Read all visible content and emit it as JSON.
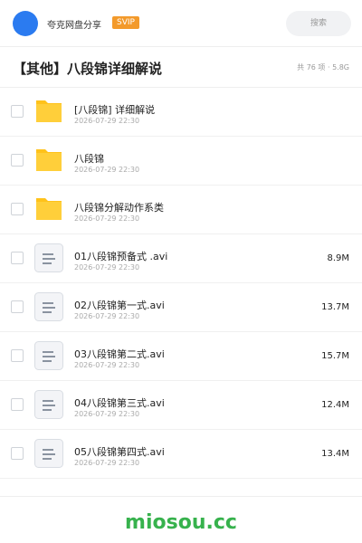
{
  "topbar": {
    "app_name": "夸克网盘分享",
    "badge": "SVIP",
    "search_label": "搜索"
  },
  "header": {
    "title": "【其他】八段锦详细解说",
    "summary": "共 76 项 · 5.8G"
  },
  "files": [
    {
      "name": " [八段锦] 详细解说",
      "date": "2026-07-29 22:30",
      "size": "",
      "type": "folder"
    },
    {
      "name": "八段锦",
      "date": "2026-07-29 22:30",
      "size": "",
      "type": "folder"
    },
    {
      "name": "八段锦分解动作系类",
      "date": "2026-07-29 22:30",
      "size": "",
      "type": "folder"
    },
    {
      "name": "01八段锦预备式 .avi",
      "date": "2026-07-29 22:30",
      "size": "8.9M",
      "type": "video"
    },
    {
      "name": "02八段锦第一式.avi",
      "date": "2026-07-29 22:30",
      "size": "13.7M",
      "type": "video"
    },
    {
      "name": "03八段锦第二式.avi",
      "date": "2026-07-29 22:30",
      "size": "15.7M",
      "type": "video"
    },
    {
      "name": "04八段锦第三式.avi",
      "date": "2026-07-29 22:30",
      "size": "12.4M",
      "type": "video"
    },
    {
      "name": "05八段锦第四式.avi",
      "date": "2026-07-29 22:30",
      "size": "13.4M",
      "type": "video"
    }
  ],
  "footer": {
    "brand": "miosou.cc"
  },
  "colors": {
    "avatar": "#2b7bf0",
    "badge": "#f39a2b",
    "folder": "#ffc21a",
    "brand": "#37b24d"
  }
}
